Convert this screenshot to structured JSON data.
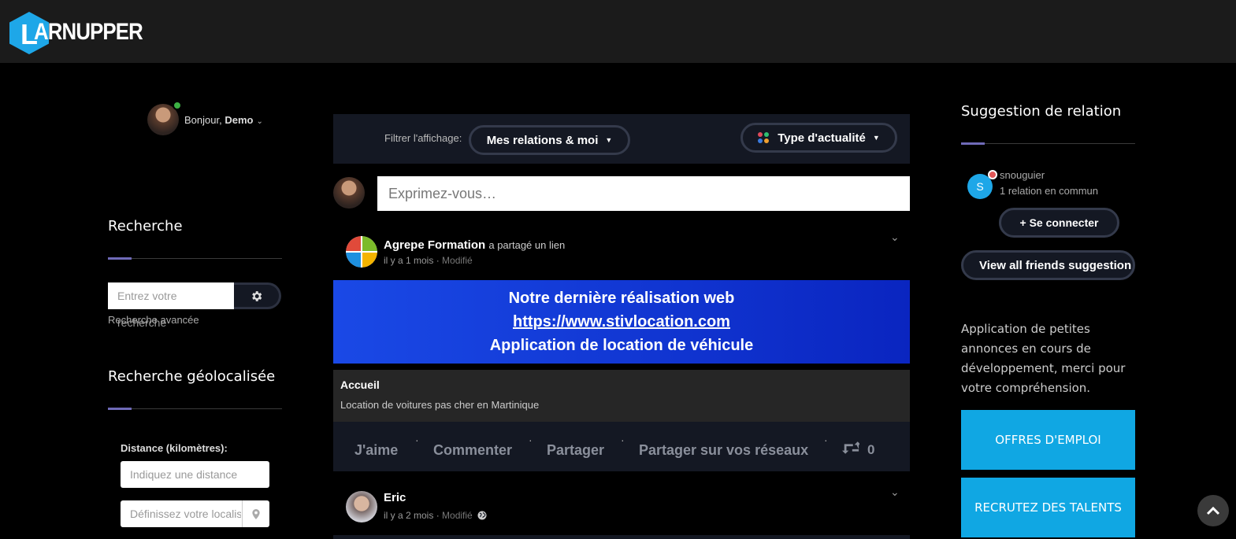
{
  "brand": {
    "logo_text": "ARNUPPER",
    "logo_letter": "L",
    "accent": "#1ea7e8"
  },
  "user": {
    "greeting_prefix": "Bonjour, ",
    "name": "Demo"
  },
  "search": {
    "title": "Recherche",
    "placeholder": "Entrez votre recherche",
    "advanced_link": "Recherche avancée"
  },
  "geo": {
    "title": "Recherche géolocalisée",
    "distance_label": "Distance (kilomètres):",
    "distance_placeholder": "Indiquez une distance",
    "location_placeholder": "Définissez votre localisation"
  },
  "feed": {
    "filter_label": "Filtrer l'affichage:",
    "filter_value": "Mes relations & moi",
    "type_value": "Type d'actualité",
    "express_placeholder": "Exprimez-vous…"
  },
  "post1": {
    "author": "Agrepe Formation",
    "action": "a partagé un lien",
    "time": "il y a 1 mois",
    "modified": "Modifié",
    "banner_line1": "Notre dernière réalisation web",
    "banner_link": " https://www.stivlocation.com",
    "banner_line3": "Application de location de véhicule",
    "card_title": "Accueil",
    "card_desc": "Location de voitures pas cher en Martinique",
    "actions": {
      "like": "J'aime",
      "comment": "Commenter",
      "share": "Partager",
      "share_networks": "Partager sur vos réseaux",
      "reposts": "0"
    }
  },
  "post2": {
    "author": "Eric",
    "time": "il y a 2 mois",
    "modified": "Modifié"
  },
  "suggestions": {
    "title": "Suggestion de relation",
    "item": {
      "initial": "S",
      "name": "snouguier",
      "common": "1 relation en commun"
    },
    "connect": "+ Se connecter",
    "view_all": "View all friends suggestion"
  },
  "notice": "Application de petites annonces en cours de développement, merci pour votre compréhension.",
  "cta": {
    "jobs": "OFFRES D'EMPLOI",
    "recruit": "RECRUTEZ DES TALENTS"
  }
}
